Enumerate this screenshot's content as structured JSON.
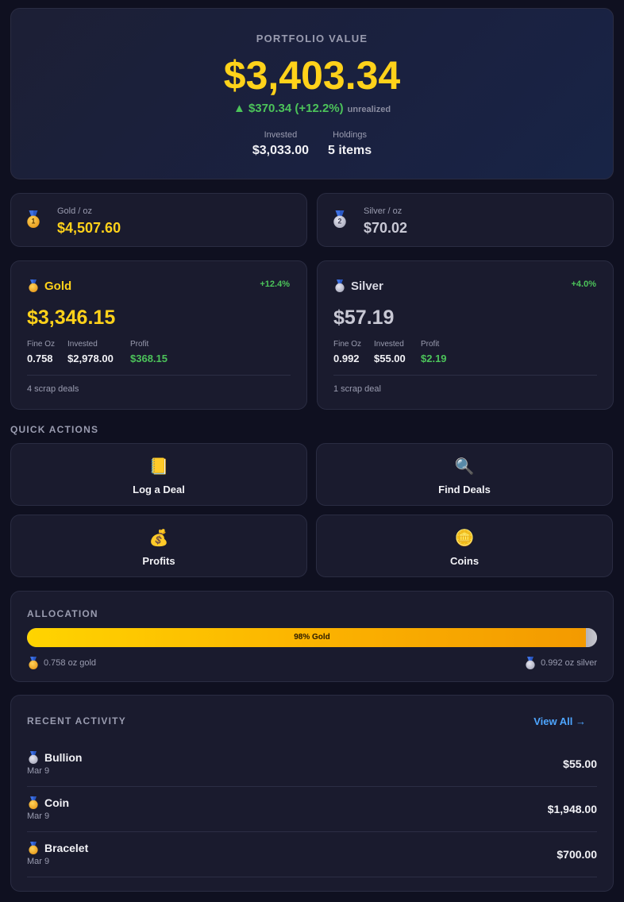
{
  "portfolio": {
    "label": "PORTFOLIO VALUE",
    "value": "$3,403.34",
    "change": "▲ $370.34 (+12.2%)",
    "change_note": "unrealized",
    "invested_label": "Invested",
    "invested_value": "$3,033.00",
    "holdings_label": "Holdings",
    "holdings_value": "5 items"
  },
  "spot": {
    "gold": {
      "label": "Gold / oz",
      "value": "$4,507.60",
      "icon": "gold-medal-icon",
      "rank": "1"
    },
    "silver": {
      "label": "Silver / oz",
      "value": "$70.02",
      "icon": "silver-medal-icon",
      "rank": "2"
    }
  },
  "metals": {
    "gold": {
      "name": "Gold",
      "change": "+12.4%",
      "value": "$3,346.15",
      "fine_oz_label": "Fine Oz",
      "fine_oz": "0.758",
      "invested_label": "Invested",
      "invested": "$2,978.00",
      "profit_label": "Profit",
      "profit": "$368.15",
      "deals": "4 scrap deals"
    },
    "silver": {
      "name": "Silver",
      "change": "+4.0%",
      "value": "$57.19",
      "fine_oz_label": "Fine Oz",
      "fine_oz": "0.992",
      "invested_label": "Invested",
      "invested": "$55.00",
      "profit_label": "Profit",
      "profit": "$2.19",
      "deals": "1 scrap deal"
    }
  },
  "quick_actions": {
    "title": "QUICK ACTIONS",
    "items": [
      {
        "label": "Log a Deal",
        "icon": "notebook-icon",
        "glyph": "📒"
      },
      {
        "label": "Find Deals",
        "icon": "magnifier-icon",
        "glyph": "🔍"
      },
      {
        "label": "Profits",
        "icon": "money-bag-icon",
        "glyph": "💰"
      },
      {
        "label": "Coins",
        "icon": "coin-icon",
        "glyph": "🪙"
      }
    ]
  },
  "allocation": {
    "title": "ALLOCATION",
    "gold_fraction": 0.98,
    "bar_label": "98% Gold",
    "gold_legend": "0.758 oz gold",
    "silver_legend": "0.992 oz silver",
    "colors": {
      "gold": "#ffd400",
      "silver": "#b8b8c0"
    }
  },
  "activity": {
    "title": "RECENT ACTIVITY",
    "view_all": "View All →",
    "rows": [
      {
        "name": "Bullion",
        "date": "Mar 9",
        "amount": "$55.00",
        "metal": "silver"
      },
      {
        "name": "Coin",
        "date": "Mar 9",
        "amount": "$1,948.00",
        "metal": "gold"
      },
      {
        "name": "Bracelet",
        "date": "Mar 9",
        "amount": "$700.00",
        "metal": "gold"
      }
    ]
  },
  "colors": {
    "gold_text": "#ffd21a",
    "silver_text": "#c8c8d4",
    "positive": "#4cc35a",
    "link": "#4ea6ff"
  }
}
